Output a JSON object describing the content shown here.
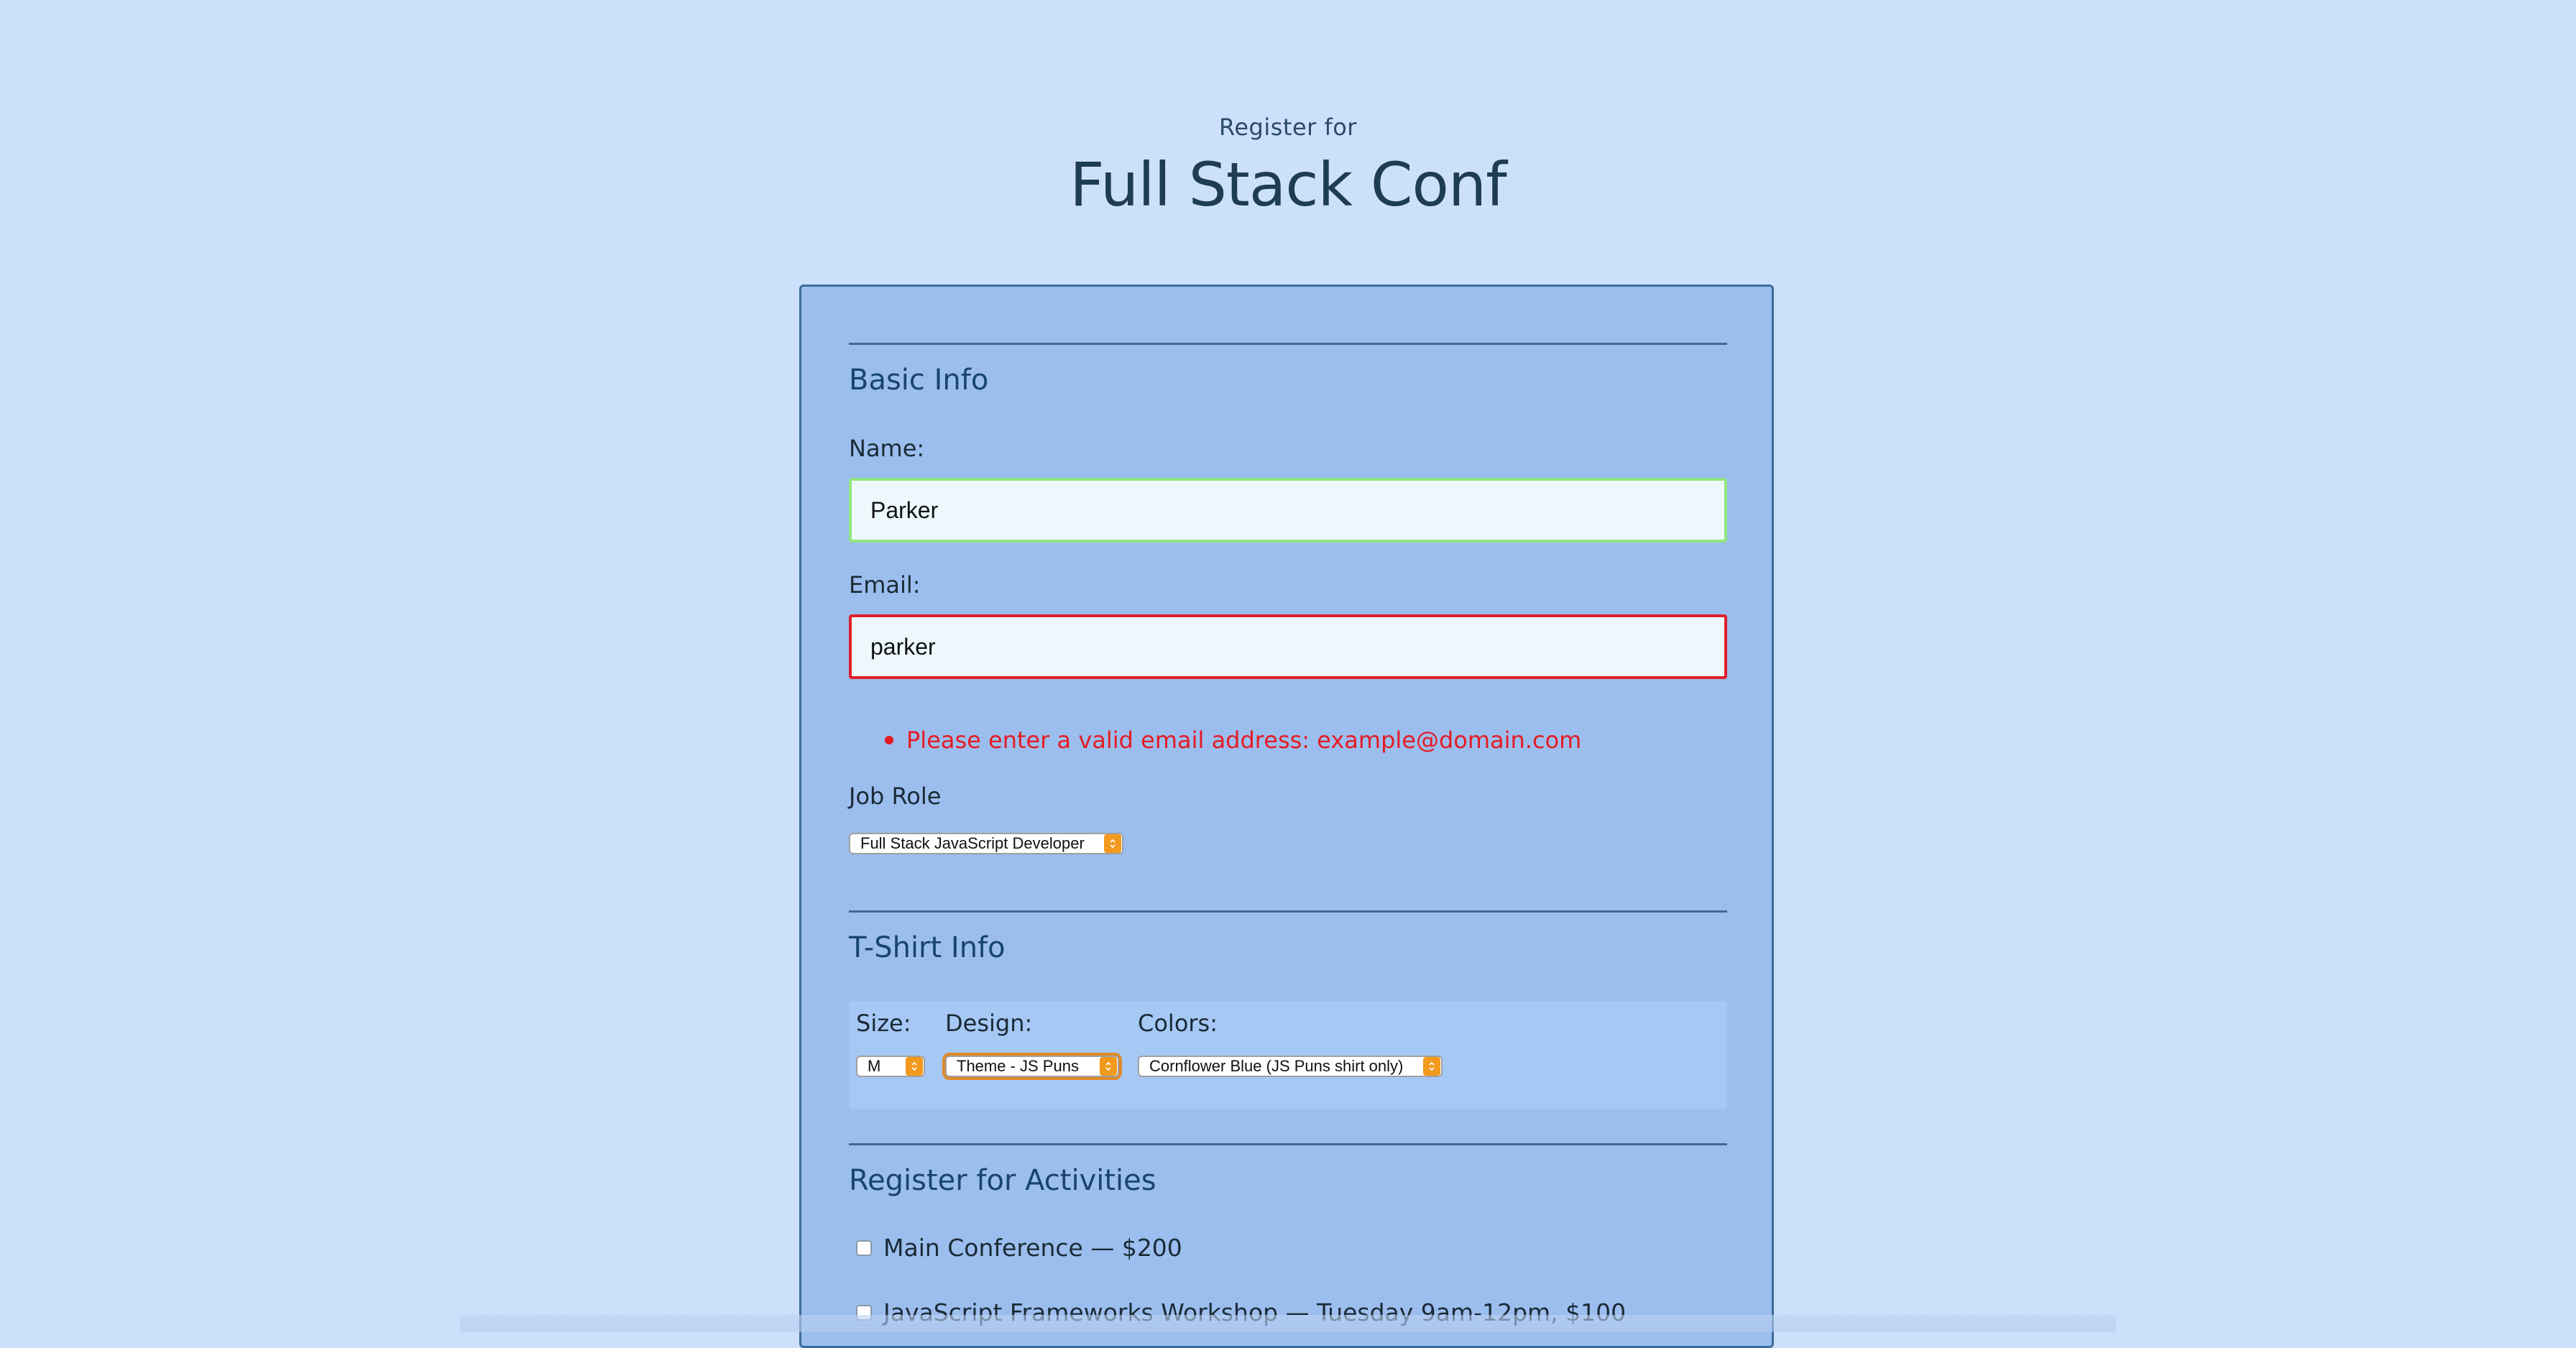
{
  "header": {
    "kicker": "Register for",
    "title": "Full Stack Conf"
  },
  "basic_info": {
    "title": "Basic Info",
    "name_label": "Name:",
    "name_value": "Parker",
    "email_label": "Email:",
    "email_value": "parker",
    "email_error": "Please enter a valid email address: example@domain.com",
    "job_role_label": "Job Role",
    "job_role_selected": "Full Stack JavaScript Developer"
  },
  "tshirt_info": {
    "title": "T-Shirt Info",
    "size_label": "Size:",
    "size_selected": "M",
    "design_label": "Design:",
    "design_selected": "Theme - JS Puns",
    "colors_label": "Colors:",
    "colors_selected": "Cornflower Blue (JS Puns shirt only)"
  },
  "activities": {
    "title": "Register for Activities",
    "items": [
      {
        "label": "Main Conference — $200",
        "checked": false
      },
      {
        "label": "JavaScript Frameworks Workshop — Tuesday 9am-12pm, $100",
        "checked": false
      }
    ]
  },
  "colors": {
    "background": "#cde0fb",
    "card": "#9cbeee",
    "valid_border": "#8ee67f",
    "invalid_border": "#e0202a",
    "error_text": "#e51b23",
    "select_arrow": "#f39a1e"
  }
}
